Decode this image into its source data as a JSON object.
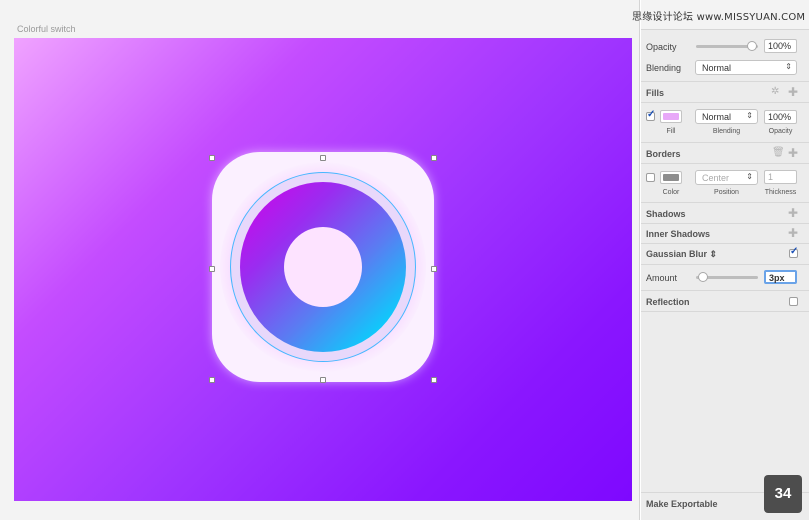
{
  "canvas": {
    "artboard_label": "Colorful switch"
  },
  "watermark": "思缘设计论坛 www.MISSYUAN.COM",
  "inspector": {
    "opacity_label": "Opacity",
    "opacity_value": "100%",
    "opacity_level": 1.0,
    "blending_label": "Blending",
    "blending_value": "Normal",
    "fills": {
      "title": "Fills",
      "swatch_color": "#e8a8f8",
      "fill_checked": true,
      "blending_value": "Normal",
      "opacity_value": "100%",
      "fill_caption": "Fill",
      "blending_caption": "Blending",
      "opacity_caption": "Opacity"
    },
    "borders": {
      "title": "Borders",
      "swatch_color": "#8e8e8e",
      "border_checked": false,
      "position_value": "Center",
      "thickness_value": "1",
      "color_caption": "Color",
      "position_caption": "Position",
      "thickness_caption": "Thickness"
    },
    "shadows_title": "Shadows",
    "inner_shadows_title": "Inner Shadows",
    "gaussian_blur": {
      "title": "Gaussian Blur",
      "checked": true,
      "amount_label": "Amount",
      "amount_value": "3px",
      "amount_level": 0.05
    },
    "reflection": {
      "title": "Reflection",
      "checked": false
    },
    "make_exportable": "Make Exportable"
  },
  "step_badge": "34",
  "colors": {
    "artboard_gradient_start": "#f0a3ff",
    "artboard_gradient_end": "#7e08ff",
    "ring_gradient_start": "#d400e8",
    "ring_gradient_end": "#00d6ff",
    "selection_outline": "#46b7ff"
  }
}
